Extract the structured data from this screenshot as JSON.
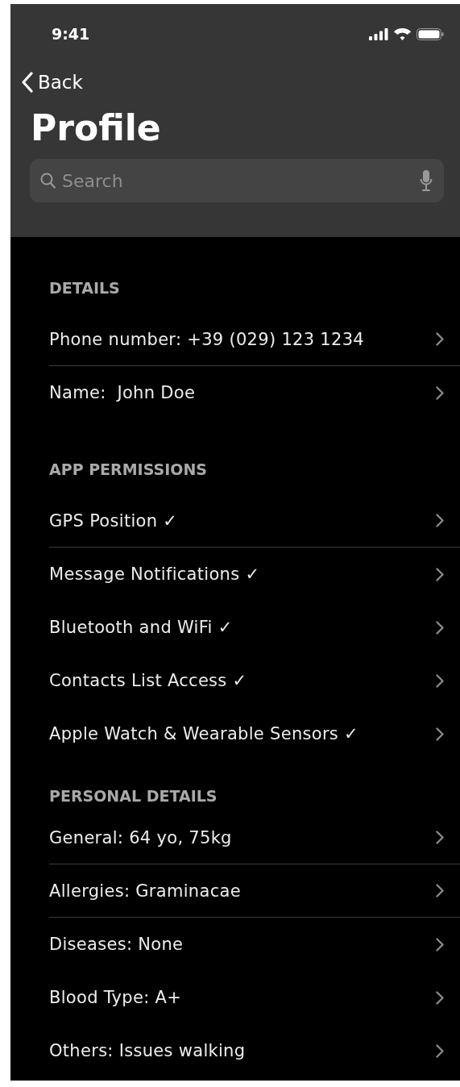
{
  "status_bar": {
    "time": "9:41"
  },
  "nav": {
    "back": "Back",
    "title": "Profile"
  },
  "search": {
    "placeholder": "Search"
  },
  "sections": [
    {
      "title": "DETAILS",
      "items": [
        {
          "label": "Phone number: +39 (029) 123 1234",
          "separator": true
        },
        {
          "label": "Name:  John Doe",
          "separator": false
        }
      ]
    },
    {
      "title": "APP PERMISSIONS",
      "items": [
        {
          "label": "GPS Position ✓",
          "separator": true
        },
        {
          "label": "Message Notifications ✓",
          "separator": false
        },
        {
          "label": "Bluetooth and WiFi ✓",
          "separator": false
        },
        {
          "label": "Contacts List Access ✓",
          "separator": false
        },
        {
          "label": "Apple Watch & Wearable Sensors ✓",
          "separator": false
        }
      ]
    },
    {
      "title": "PERSONAL DETAILS",
      "items": [
        {
          "label": "General: 64 yo, 75kg",
          "separator": true
        },
        {
          "label": "Allergies: Graminacae",
          "separator": true
        },
        {
          "label": "Diseases: None",
          "separator": false
        },
        {
          "label": "Blood Type: A+",
          "separator": false
        },
        {
          "label": "Others: Issues walking",
          "separator": false
        }
      ]
    }
  ]
}
